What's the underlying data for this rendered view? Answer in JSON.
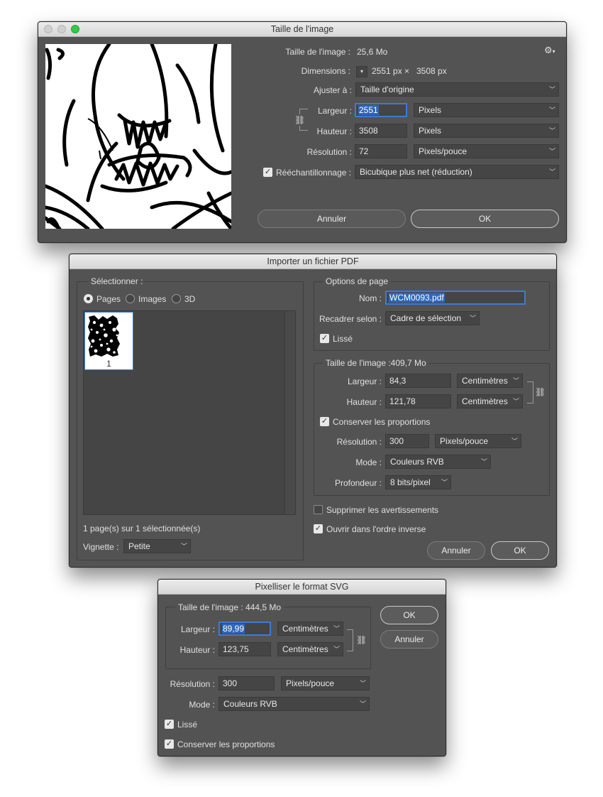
{
  "dialog1": {
    "title": "Taille de l'image",
    "size_label": "Taille de l'image :",
    "size_value": "25,6 Mo",
    "dimensions_label": "Dimensions :",
    "dimensions_w": "2551 px",
    "dimensions_x": "×",
    "dimensions_h": "3508 px",
    "fit_label": "Ajuster à :",
    "fit_value": "Taille d'origine",
    "width_label": "Largeur :",
    "width_value": "2551",
    "width_unit": "Pixels",
    "height_label": "Hauteur :",
    "height_value": "3508",
    "height_unit": "Pixels",
    "resolution_label": "Résolution :",
    "resolution_value": "72",
    "resolution_unit": "Pixels/pouce",
    "resample_label": "Rééchantillonnage :",
    "resample_value": "Bicubique plus net (réduction)",
    "cancel_label": "Annuler",
    "ok_label": "OK"
  },
  "dialog2": {
    "title": "Importer un fichier PDF",
    "select_label": "Sélectionner :",
    "radio_pages": "Pages",
    "radio_images": "Images",
    "radio_3d": "3D",
    "thumb_number": "1",
    "selection_status": "1 page(s) sur 1 sélectionnée(s)",
    "thumb_size_label": "Vignette :",
    "thumb_size_value": "Petite",
    "page_options_title": "Options de page",
    "name_label": "Nom :",
    "name_value": "WCM0093.pdf",
    "crop_label": "Recadrer selon :",
    "crop_value": "Cadre de sélection",
    "smooth_label": "Lissé",
    "image_size_title": "Taille de l'image :409,7 Mo",
    "width_label": "Largeur :",
    "width_value": "84,3",
    "width_unit": "Centimètres",
    "height_label": "Hauteur :",
    "height_value": "121,78",
    "height_unit": "Centimètres",
    "keep_proportions_label": "Conserver les proportions",
    "resolution_label": "Résolution :",
    "resolution_value": "300",
    "resolution_unit": "Pixels/pouce",
    "mode_label": "Mode :",
    "mode_value": "Couleurs RVB",
    "depth_label": "Profondeur :",
    "depth_value": "8 bits/pixel",
    "suppress_warnings_label": "Supprimer les avertissements",
    "reverse_order_label": "Ouvrir dans l'ordre inverse",
    "cancel_label": "Annuler",
    "ok_label": "OK"
  },
  "dialog3": {
    "title": "Pixelliser le format SVG",
    "image_size_title": "Taille de l'image : 444,5 Mo",
    "width_label": "Largeur :",
    "width_value": "89,99",
    "width_unit": "Centimètres",
    "height_label": "Hauteur :",
    "height_value": "123,75",
    "height_unit": "Centimètres",
    "resolution_label": "Résolution :",
    "resolution_value": "300",
    "resolution_unit": "Pixels/pouce",
    "mode_label": "Mode :",
    "mode_value": "Couleurs RVB",
    "smooth_label": "Lissé",
    "keep_proportions_label": "Conserver les proportions",
    "ok_label": "OK",
    "cancel_label": "Annuler"
  }
}
